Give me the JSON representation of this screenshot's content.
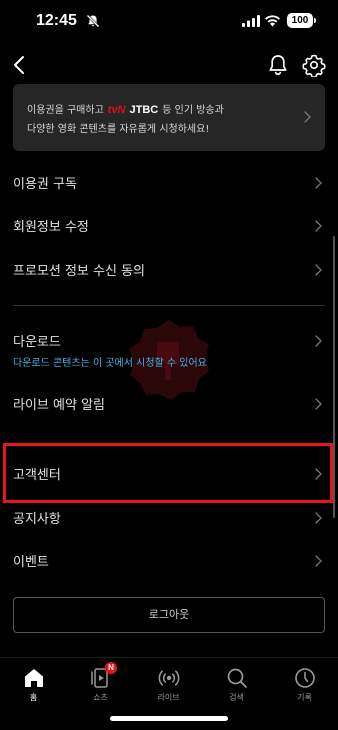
{
  "status_bar": {
    "time": "12:45",
    "battery": "100"
  },
  "banner": {
    "line1_pre": "이용권을 구매하고",
    "brand1": "tvN",
    "brand2": "JTBC",
    "line1_post": "등 인기 방송과",
    "line2": "다양한 영화 콘텐츠를 자유롭게 시청하세요!"
  },
  "menu": {
    "subscription": "이용권 구독",
    "edit_profile": "회원정보 수정",
    "promo_consent": "프로모션 정보 수신 동의",
    "download": "다운로드",
    "download_sub": "다운로드 콘텐츠는 이 곳에서 시청할 수 있어요",
    "live_alert": "라이브 예약 알림",
    "customer_center": "고객센터",
    "notice": "공지사항",
    "event": "이벤트"
  },
  "logout_label": "로그아웃",
  "tabs": {
    "home": "홈",
    "shorts": "쇼츠",
    "shorts_badge": "N",
    "live": "라이브",
    "search": "검색",
    "history": "기록"
  },
  "colors": {
    "accent": "#e8141c",
    "link": "#3fb6e8",
    "banner_bg": "#262626",
    "background": "#000000"
  },
  "icons": [
    "back-icon",
    "bell-icon",
    "gear-icon",
    "chevron-right-icon",
    "home-icon",
    "shorts-icon",
    "live-icon",
    "search-icon",
    "history-icon"
  ]
}
